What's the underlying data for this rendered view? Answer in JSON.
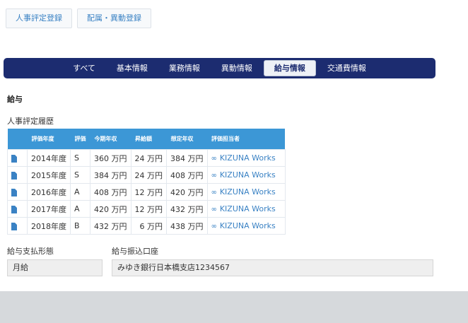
{
  "top_buttons": [
    {
      "label": "人事評定登録"
    },
    {
      "label": "配属・異動登録"
    }
  ],
  "tabs": [
    {
      "label": "すべて"
    },
    {
      "label": "基本情報"
    },
    {
      "label": "業務情報"
    },
    {
      "label": "異動情報"
    },
    {
      "label": "給与情報",
      "active": true
    },
    {
      "label": "交通費情報"
    }
  ],
  "section": {
    "title": "給与"
  },
  "history": {
    "title": "人事評定履歴",
    "headers": [
      "",
      "評価年度",
      "評価",
      "今期年収",
      "昇給額",
      "想定年収",
      "評価担当者"
    ],
    "rows": [
      {
        "year": "2014年度",
        "grade": "S",
        "income": "360 万円",
        "raise": "24 万円",
        "expected": "384 万円",
        "evaluator": "KIZUNA Works"
      },
      {
        "year": "2015年度",
        "grade": "S",
        "income": "384 万円",
        "raise": "24 万円",
        "expected": "408 万円",
        "evaluator": "KIZUNA Works"
      },
      {
        "year": "2016年度",
        "grade": "A",
        "income": "408 万円",
        "raise": "12 万円",
        "expected": "420 万円",
        "evaluator": "KIZUNA Works"
      },
      {
        "year": "2017年度",
        "grade": "A",
        "income": "420 万円",
        "raise": "12 万円",
        "expected": "432 万円",
        "evaluator": "KIZUNA Works"
      },
      {
        "year": "2018年度",
        "grade": "B",
        "income": "432 万円",
        "raise": "6 万円",
        "expected": "438 万円",
        "evaluator": "KIZUNA Works"
      }
    ]
  },
  "payment": {
    "label": "給与支払形態",
    "value": "月給"
  },
  "bank": {
    "label": "給与振込口座",
    "value": "みゆき銀行日本橋支店1234567"
  },
  "icons": {
    "row_doc": "document-icon",
    "evaluator_link": "link-icon"
  },
  "colors": {
    "tab_bar": "#1c2c70",
    "table_header": "#3c97d6",
    "link": "#3a82c4"
  }
}
